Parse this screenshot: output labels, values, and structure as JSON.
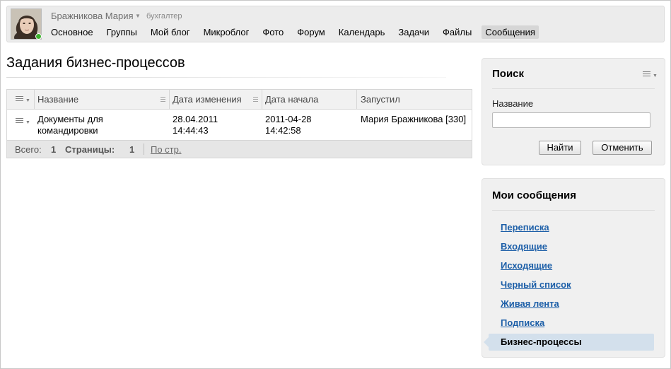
{
  "header": {
    "user_name": "Бражникова Мария",
    "user_role": "бухгалтер",
    "nav": [
      "Основное",
      "Группы",
      "Мой блог",
      "Микроблог",
      "Фото",
      "Форум",
      "Календарь",
      "Задачи",
      "Файлы",
      "Сообщения"
    ],
    "active_nav": "Сообщения"
  },
  "main": {
    "title": "Задания бизнес-процессов",
    "grid": {
      "columns": [
        "Название",
        "Дата изменения",
        "Дата начала",
        "Запустил"
      ],
      "rows": [
        [
          "Документы для командировки",
          "28.04.2011 14:44:43",
          "2011-04-28 14:42:58",
          "Мария Бражникова [330]"
        ]
      ],
      "footer": {
        "total_label": "Всего:",
        "total_value": "1",
        "pages_label": "Страницы:",
        "pages_value": "1",
        "per_page_link": "По стр."
      }
    }
  },
  "sidebar": {
    "search": {
      "title": "Поиск",
      "field_label": "Название",
      "field_value": "",
      "find_button": "Найти",
      "cancel_button": "Отменить"
    },
    "messages": {
      "title": "Мои сообщения",
      "links": [
        "Переписка",
        "Входящие",
        "Исходящие",
        "Черный список",
        "Живая лента",
        "Подписка"
      ],
      "active_item": "Бизнес-процессы"
    }
  },
  "colors": {
    "link": "#1d5fa8",
    "active_bg": "#d3e0ec",
    "online": "#3cb22e",
    "panel_bg": "#f0f0f0"
  }
}
